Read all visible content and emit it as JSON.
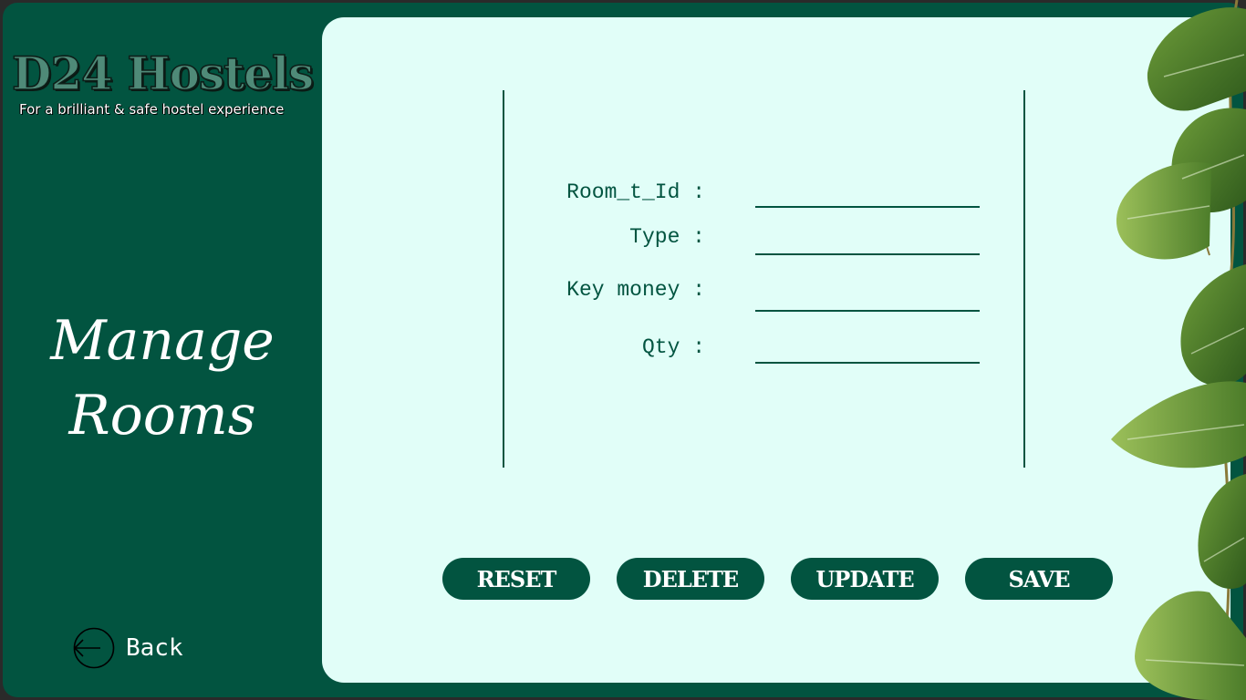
{
  "logo": {
    "title": "D24 Hostels",
    "tagline": "For a brilliant & safe hostel experience"
  },
  "sidebar": {
    "page_title_line1": "Manage",
    "page_title_line2": "Rooms",
    "back_label": "Back",
    "back_icon": "arrow-left-circle-icon"
  },
  "form": {
    "fields": [
      {
        "label": "Room_t_Id :",
        "value": ""
      },
      {
        "label": "Type :",
        "value": ""
      },
      {
        "label": "Key money :",
        "value": ""
      },
      {
        "label": "Qty :",
        "value": ""
      }
    ]
  },
  "actions": {
    "reset_label": "RESET",
    "delete_label": "DELETE",
    "update_label": "UPDATE",
    "save_label": "SAVE"
  },
  "colors": {
    "primary": "#025440",
    "panel": "#e1fef8",
    "logo_fill": "#4f8a78",
    "text_light": "#ffffff"
  },
  "decoration": {
    "plant_icon": "monstera-leaves-icon"
  }
}
